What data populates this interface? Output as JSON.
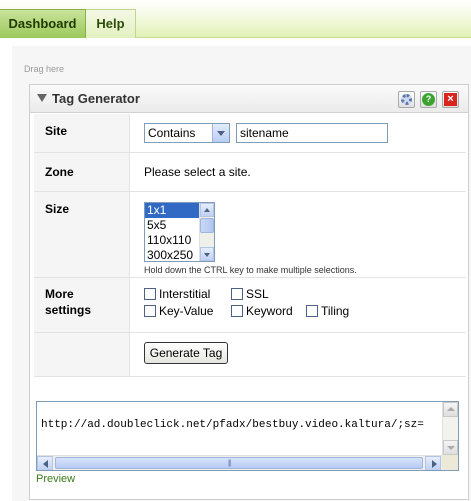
{
  "nav": {
    "tabs": [
      {
        "label": "Dashboard"
      },
      {
        "label": "Help"
      }
    ]
  },
  "dashboard": {
    "drag_here": "Drag here"
  },
  "widget": {
    "title": "Tag Generator",
    "icons": [
      "settings-gear-icon",
      "help-icon",
      "close-icon"
    ],
    "site": {
      "label": "Site",
      "match_mode": "Contains",
      "value": "sitename"
    },
    "zone": {
      "label": "Zone",
      "message": "Please select a site."
    },
    "size": {
      "label": "Size",
      "options": [
        "1x1",
        "5x5",
        "110x110",
        "300x250"
      ],
      "selected": "1x1",
      "hint": "Hold down the CTRL key to make multiple selections."
    },
    "more_settings": {
      "label_line1": "More",
      "label_line2": "settings",
      "checkboxes": [
        {
          "label": "Interstitial",
          "checked": false
        },
        {
          "label": "SSL",
          "checked": false
        },
        {
          "label": "Key-Value",
          "checked": false
        },
        {
          "label": "Keyword",
          "checked": false
        },
        {
          "label": "Tiling",
          "checked": false
        }
      ]
    },
    "generate_button": "Generate Tag",
    "output": "http://ad.doubleclick.net/pfadx/bestbuy.video.kaltura/;sz=",
    "preview_link": "Preview"
  },
  "colors": {
    "nav_active": "#9bc95b",
    "nav_bar": "#e3f1b7",
    "link": "#3a7b1a",
    "selection": "#316ac5"
  }
}
